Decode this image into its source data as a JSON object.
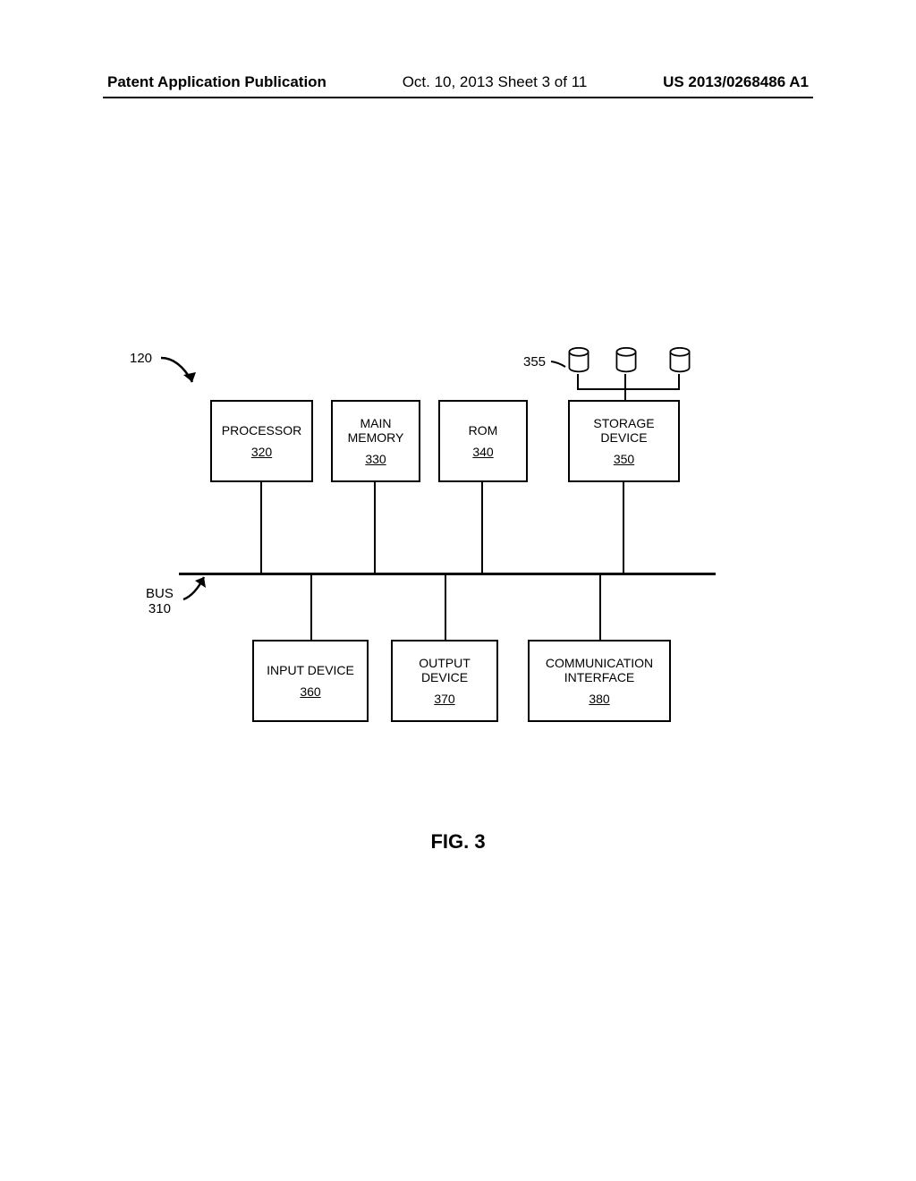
{
  "header": {
    "left": "Patent Application Publication",
    "center": "Oct. 10, 2013  Sheet 3 of 11",
    "right": "US 2013/0268486 A1"
  },
  "refs": {
    "r120": "120",
    "r355": "355",
    "bus": "BUS",
    "bus_num": "310"
  },
  "boxes": {
    "processor": {
      "label": "PROCESSOR",
      "ref": "320"
    },
    "memory": {
      "line1": "MAIN",
      "line2": "MEMORY",
      "ref": "330"
    },
    "rom": {
      "label": "ROM",
      "ref": "340"
    },
    "storage": {
      "line1": "STORAGE",
      "line2": "DEVICE",
      "ref": "350"
    },
    "input": {
      "label": "INPUT DEVICE",
      "ref": "360"
    },
    "output": {
      "line1": "OUTPUT",
      "line2": "DEVICE",
      "ref": "370"
    },
    "comm": {
      "line1": "COMMUNICATION",
      "line2": "INTERFACE",
      "ref": "380"
    }
  },
  "caption": "FIG. 3"
}
